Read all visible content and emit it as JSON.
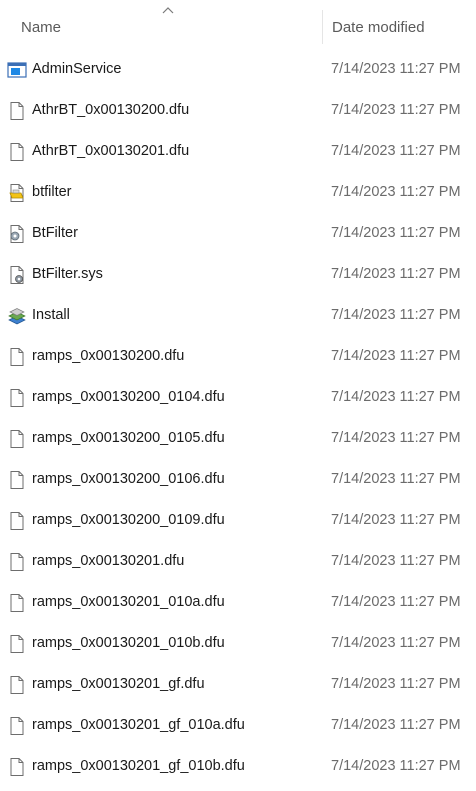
{
  "columns": {
    "name_label": "Name",
    "date_label": "Date modified",
    "sort": "ascending"
  },
  "files": [
    {
      "name": "AdminService",
      "date": "7/14/2023 11:27 PM",
      "icon": "application-window-icon"
    },
    {
      "name": "AthrBT_0x00130200.dfu",
      "date": "7/14/2023 11:27 PM",
      "icon": "blank-file-icon"
    },
    {
      "name": "AthrBT_0x00130201.dfu",
      "date": "7/14/2023 11:27 PM",
      "icon": "blank-file-icon"
    },
    {
      "name": "btfilter",
      "date": "7/14/2023 11:27 PM",
      "icon": "setup-information-file-icon"
    },
    {
      "name": "BtFilter",
      "date": "7/14/2023 11:27 PM",
      "icon": "catalog-file-icon"
    },
    {
      "name": "BtFilter.sys",
      "date": "7/14/2023 11:27 PM",
      "icon": "system-file-icon"
    },
    {
      "name": "Install",
      "date": "7/14/2023 11:27 PM",
      "icon": "installer-icon"
    },
    {
      "name": "ramps_0x00130200.dfu",
      "date": "7/14/2023 11:27 PM",
      "icon": "blank-file-icon"
    },
    {
      "name": "ramps_0x00130200_0104.dfu",
      "date": "7/14/2023 11:27 PM",
      "icon": "blank-file-icon"
    },
    {
      "name": "ramps_0x00130200_0105.dfu",
      "date": "7/14/2023 11:27 PM",
      "icon": "blank-file-icon"
    },
    {
      "name": "ramps_0x00130200_0106.dfu",
      "date": "7/14/2023 11:27 PM",
      "icon": "blank-file-icon"
    },
    {
      "name": "ramps_0x00130200_0109.dfu",
      "date": "7/14/2023 11:27 PM",
      "icon": "blank-file-icon"
    },
    {
      "name": "ramps_0x00130201.dfu",
      "date": "7/14/2023 11:27 PM",
      "icon": "blank-file-icon"
    },
    {
      "name": "ramps_0x00130201_010a.dfu",
      "date": "7/14/2023 11:27 PM",
      "icon": "blank-file-icon"
    },
    {
      "name": "ramps_0x00130201_010b.dfu",
      "date": "7/14/2023 11:27 PM",
      "icon": "blank-file-icon"
    },
    {
      "name": "ramps_0x00130201_gf.dfu",
      "date": "7/14/2023 11:27 PM",
      "icon": "blank-file-icon"
    },
    {
      "name": "ramps_0x00130201_gf_010a.dfu",
      "date": "7/14/2023 11:27 PM",
      "icon": "blank-file-icon"
    },
    {
      "name": "ramps_0x00130201_gf_010b.dfu",
      "date": "7/14/2023 11:27 PM",
      "icon": "blank-file-icon"
    }
  ]
}
